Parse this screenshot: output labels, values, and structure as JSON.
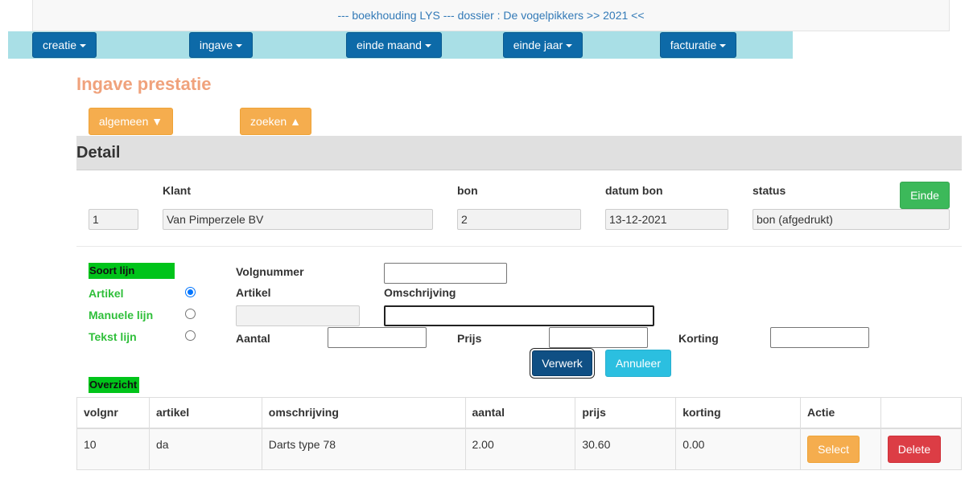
{
  "header": {
    "title": "--- boekhouding LYS --- dossier : De vogelpikkers >> 2021 <<"
  },
  "nav": {
    "creatie": "creatie",
    "ingave": "ingave",
    "einde_maand": "einde maand",
    "einde_jaar": "einde jaar",
    "facturatie": "facturatie"
  },
  "page": {
    "title": "Ingave prestatie"
  },
  "toggles": {
    "algemeen": "algemeen ▼",
    "zoeken": "zoeken ▲"
  },
  "detail": {
    "title": "Detail",
    "labels": {
      "klant": "Klant",
      "bon": "bon",
      "datum_bon": "datum bon",
      "status": "status"
    },
    "values": {
      "nr": "1",
      "klant": "Van Pimperzele BV",
      "bon": "2",
      "datum_bon": "13-12-2021",
      "status": "bon (afgedrukt)"
    },
    "einde_label": "Einde"
  },
  "line_form": {
    "soort_lijn": "Soort lijn",
    "options": {
      "artikel": "Artikel",
      "manuele": "Manuele lijn",
      "tekst": "Tekst lijn"
    },
    "selected_option": "artikel",
    "labels": {
      "volgnummer": "Volgnummer",
      "artikel": "Artikel",
      "omschrijving": "Omschrijving",
      "aantal": "Aantal",
      "prijs": "Prijs",
      "korting": "Korting"
    },
    "values": {
      "volgnummer": "",
      "artikel": "",
      "omschrijving": "",
      "aantal": "",
      "prijs": "",
      "korting": ""
    },
    "verwerk_label": "Verwerk",
    "annuleer_label": "Annuleer"
  },
  "overview": {
    "title": "Overzicht",
    "columns": {
      "volgnr": "volgnr",
      "artikel": "artikel",
      "omschrijving": "omschrijving",
      "aantal": "aantal",
      "prijs": "prijs",
      "korting": "korting",
      "actie": "Actie"
    },
    "rows": [
      {
        "volgnr": "10",
        "artikel": "da",
        "omschrijving": "Darts type 78",
        "aantal": "2.00",
        "prijs": "30.60",
        "korting": "0.00",
        "select_label": "Select",
        "delete_label": "Delete"
      }
    ]
  }
}
